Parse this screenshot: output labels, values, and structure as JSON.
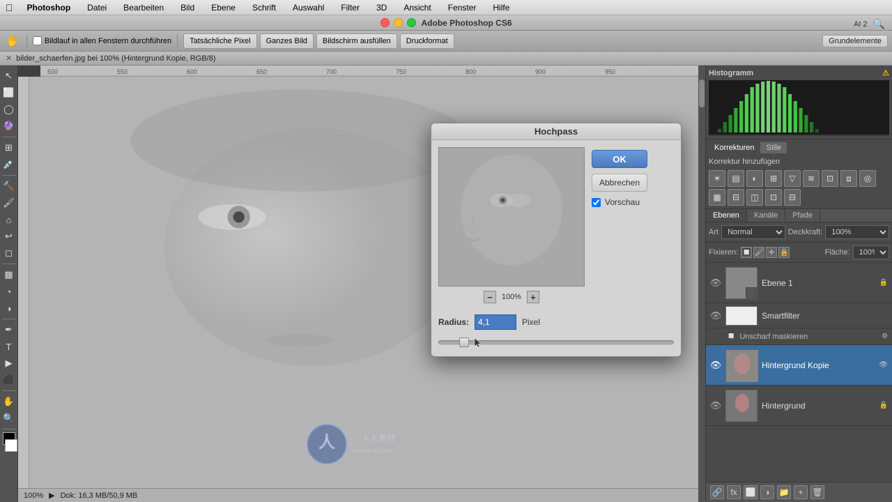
{
  "app": {
    "name": "Photoshop",
    "title": "Adobe Photoshop CS6",
    "workspace": "Grundelemente"
  },
  "menubar": {
    "apple": "⌘",
    "items": [
      "Photoshop",
      "Datei",
      "Bearbeiten",
      "Bild",
      "Ebene",
      "Schrift",
      "Auswahl",
      "Filter",
      "3D",
      "Ansicht",
      "Fenster",
      "Hilfe"
    ]
  },
  "toolbar": {
    "checkbox_label": "Bildlauf in allen Fenstern durchführen",
    "btn1": "Tatsächliche Pixel",
    "btn2": "Ganzes Bild",
    "btn3": "Bildschirm ausfüllen",
    "btn4": "Druckformat"
  },
  "document": {
    "tab": "bilder_schaerfen.jpg bei 100% (Hintergrund Kopie, RGB/8)",
    "zoom": "100%",
    "info": "Dok: 16,3 MB/50,9 MB"
  },
  "dialog": {
    "title": "Hochpass",
    "ok_label": "OK",
    "cancel_label": "Abbrechen",
    "preview_label": "Vorschau",
    "radius_label": "Radius:",
    "radius_value": "4,1",
    "radius_unit": "Pixel",
    "zoom_percent": "100%"
  },
  "histogram": {
    "title": "Histogramm"
  },
  "korrekturen": {
    "tab1": "Korrekturen",
    "tab2": "Stile",
    "subtitle": "Korrektur hinzufügen",
    "icons": [
      "☀",
      "▤",
      "◐",
      "⊞",
      "▽",
      "≋",
      "⊡",
      "⧈",
      "⊠",
      "▦",
      "⊟",
      "⊞",
      "⊡",
      "⊟"
    ]
  },
  "ebenen": {
    "tab1": "Ebenen",
    "tab2": "Kanäle",
    "tab3": "Pfade",
    "mode_label": "Normal",
    "opacity_label": "Deckkraft:",
    "opacity_value": "100%",
    "fixieren_label": "Fixieren:",
    "flaeche_label": "Fläche:",
    "flaeche_value": "100%",
    "layers": [
      {
        "name": "Ebene 1",
        "visible": true,
        "thumb_color": "#888"
      },
      {
        "name": "Smartfilter",
        "visible": true,
        "thumb_color": "#fff"
      },
      {
        "name": "Unscharf maskieren",
        "is_filter": true
      },
      {
        "name": "Hintergrund Kopie",
        "visible": true,
        "thumb_color": "#666",
        "active": true
      },
      {
        "name": "Hintergrund",
        "visible": true,
        "thumb_color": "#555",
        "locked": true
      }
    ]
  },
  "statusbar": {
    "zoom": "100%",
    "info": "Dok: 16,3 MB/50,9 MB"
  },
  "watermark2": "video2brain.de"
}
